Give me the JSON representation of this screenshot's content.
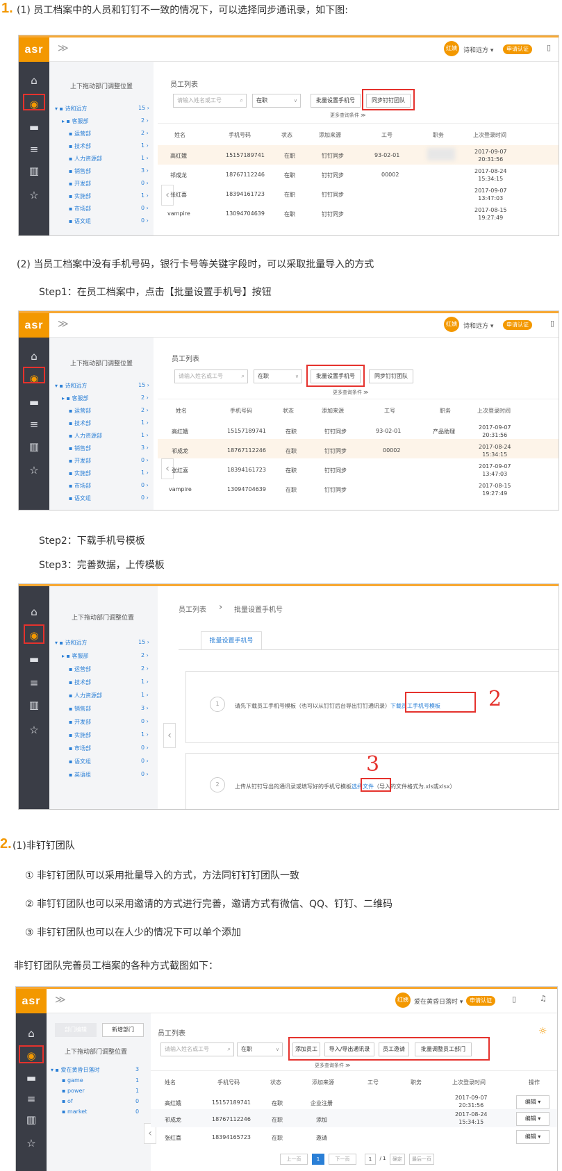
{
  "section1": {
    "num": "1.",
    "text": "(1) 员工档案中的人员和钉钉不一致的情况下，可以选择同步通讯录，如下图:"
  },
  "section2_text": "(2) 当员工档案中没有手机号码，银行卡号等关键字段时，可以采取批量导入的方式",
  "step1": "Step1：在员工档案中，点击【批量设置手机号】按钮",
  "step2": "Step2：下载手机号模板",
  "step3": "Step3：完善数据，上传模板",
  "section3": {
    "num": "2.",
    "title": "(1)非钉钉团队",
    "items": [
      "① 非钉钉团队可以采用批量导入的方式，方法同钉钉钉团队一致",
      "② 非钉钉团队也可以采用邀请的方式进行完善，邀请方式有微信、QQ、钉钉、二维码",
      "③ 非钉钉团队也可以在人少的情况下可以单个添加"
    ],
    "caption": "非钉钉团队完善员工档案的各种方式截图如下："
  },
  "app": {
    "logo": "asr",
    "chevron": "≫",
    "avatar": "红姨",
    "user": "诗和远方 ▾",
    "auth": "申请认证",
    "tree_hint": "上下拖动部门调整位置",
    "list_title": "员工列表",
    "search_placeholder": "请输入姓名或工号",
    "status_select": "在职",
    "btn_batch_phone": "批量设置手机号",
    "btn_sync": "同步钉钉团队",
    "more_filters": "更多查询条件 ≫",
    "tree": [
      {
        "name": "▾ ▪ 诗和远方",
        "count": "15 ›"
      },
      {
        "name": "▸ ▪ 客服部",
        "count": "2 ›"
      },
      {
        "name": "▪ 运营部",
        "count": "2 ›"
      },
      {
        "name": "▪ 技术部",
        "count": "1 ›"
      },
      {
        "name": "▪ 人力资源部",
        "count": "1 ›"
      },
      {
        "name": "▪ 销售部",
        "count": "3 ›"
      },
      {
        "name": "▪ 开发部",
        "count": "0 ›"
      },
      {
        "name": "▪ 实施部",
        "count": "1 ›"
      },
      {
        "name": "▪ 市场部",
        "count": "0 ›"
      },
      {
        "name": "▪ 语文组",
        "count": "0 ›"
      },
      {
        "name": "▪ 英语组",
        "count": "0 ›"
      }
    ],
    "columns": [
      "姓名",
      "手机号码",
      "状态",
      "添加来源",
      "工号",
      "职务",
      "上次登录时间"
    ],
    "rows": [
      {
        "name": "高红娥",
        "phone": "15157189741",
        "status": "在职",
        "source": "钉钉同步",
        "no": "93-02-01",
        "job": "产品助理",
        "d1": "2017-09-07",
        "d2": "20:31:56"
      },
      {
        "name": "祁成龙",
        "phone": "18767112246",
        "status": "在职",
        "source": "钉钉同步",
        "no": "00002",
        "job": "",
        "d1": "2017-08-24",
        "d2": "15:34:15"
      },
      {
        "name": "张红喜",
        "phone": "18394161723",
        "status": "在职",
        "source": "钉钉同步",
        "no": "",
        "job": "",
        "d1": "2017-09-07",
        "d2": "13:47:03"
      },
      {
        "name": "vampire",
        "phone": "13094704639",
        "status": "在职",
        "source": "钉钉同步",
        "no": "",
        "job": "",
        "d1": "2017-08-15",
        "d2": "19:27:49"
      }
    ],
    "crumb1": "员工列表",
    "crumb_sep": "›",
    "crumb2": "批量设置手机号",
    "tab": "批量设置手机号",
    "step_a_num": "1",
    "step_a_text": "请先下载员工手机号模板（也可以从钉钉后台导出钉钉通讯录）",
    "step_a_link": "下载员工手机号模板",
    "step_b_num": "2",
    "step_b_text": "上传从钉钉导出的通讯录或填写好的手机号模板",
    "step_b_link": "选择文件",
    "step_b_tail": "（导入的文件格式为.xls或xlsx）",
    "hand2": "2",
    "hand3": "3"
  },
  "app4": {
    "avatar": "红姨",
    "user": "爱在黄昏日落时 ▾",
    "auth": "申请认证",
    "btn_dept_edit": "部门编辑",
    "btn_new_dept": "新增部门",
    "tree_hint": "上下拖动部门调整位置",
    "list_title": "员工列表",
    "search_placeholder": "请输入姓名或工号",
    "status_select": "在职",
    "btn_add": "添加员工",
    "btn_import": "导入/导出通讯录",
    "btn_invite": "员工邀请",
    "btn_batch_dept": "批量调整员工部门",
    "more_filters": "更多查询条件 ≫",
    "tree": [
      {
        "name": "▾ ▪ 爱在黄昏日落时",
        "count": "3"
      },
      {
        "name": "▪ game",
        "count": "1"
      },
      {
        "name": "▪ power",
        "count": "1"
      },
      {
        "name": "▪ of",
        "count": "0"
      },
      {
        "name": "▪ market",
        "count": "0"
      }
    ],
    "columns": [
      "姓名",
      "手机号码",
      "状态",
      "添加来源",
      "工号",
      "职务",
      "上次登录时间",
      "操作"
    ],
    "rows": [
      {
        "name": "高红娥",
        "phone": "15157189741",
        "status": "在职",
        "source": "企业注册",
        "d1": "2017-09-07",
        "d2": "20:31:56",
        "op": "编辑 ▾"
      },
      {
        "name": "祁成龙",
        "phone": "18767112246",
        "status": "在职",
        "source": "添加",
        "d1": "2017-08-24",
        "d2": "15:34:15",
        "op": "编辑 ▾"
      },
      {
        "name": "张红喜",
        "phone": "18394165723",
        "status": "在职",
        "source": "邀请",
        "d1": "",
        "d2": "",
        "op": "编辑 ▾"
      }
    ],
    "pager_prev": "上一页",
    "pager_cur": "1",
    "pager_next": "下一页",
    "pager_input": "1",
    "pager_total": "/ 1",
    "pager_go": "确定",
    "pager_last": "最后一页"
  }
}
